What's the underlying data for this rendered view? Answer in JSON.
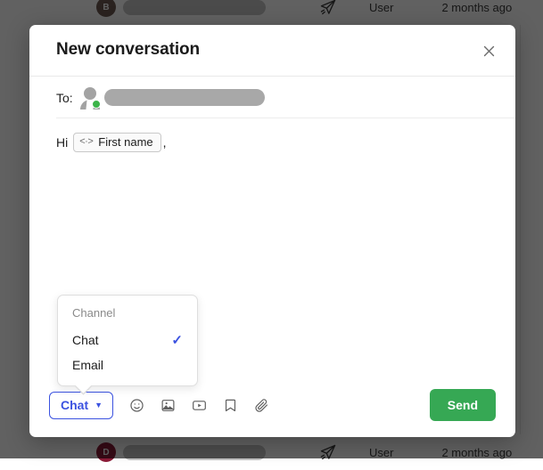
{
  "background": {
    "rows": [
      {
        "avatar_initial": "B",
        "avatar_color": "#6e5b52",
        "name": "",
        "send_icon": "paper-plane-icon",
        "role": "User",
        "time": "2 months ago"
      },
      {
        "avatar_initial": "D",
        "avatar_color": "#8d1c38",
        "name": "",
        "send_icon": "paper-plane-icon",
        "role": "User",
        "time": "2 months ago"
      }
    ]
  },
  "modal": {
    "title": "New conversation",
    "close_icon": "close-icon",
    "to": {
      "label": "To:",
      "avatar_icon": "person-avatar-icon",
      "status": "online",
      "status_color": "#3cb44a",
      "recipient": ""
    },
    "composer": {
      "greeting_prefix": "Hi",
      "token_icon": "variable-icon",
      "token_symbol": "<·>",
      "token_label": "First name",
      "greeting_suffix": ","
    },
    "dropdown": {
      "header": "Channel",
      "items": [
        {
          "label": "Chat",
          "selected": true,
          "check": "✓"
        },
        {
          "label": "Email",
          "selected": false,
          "check": "✓"
        }
      ],
      "accent_color": "#3b52e0"
    },
    "toolbar": {
      "channel_button_label": "Chat",
      "channel_button_caret": "▼",
      "channel_button_color": "#3b52e0",
      "icons": [
        {
          "name": "emoji-icon"
        },
        {
          "name": "image-icon"
        },
        {
          "name": "video-icon"
        },
        {
          "name": "saved-reply-icon"
        },
        {
          "name": "attachment-icon"
        }
      ],
      "send_label": "Send",
      "send_color": "#36a854"
    }
  }
}
